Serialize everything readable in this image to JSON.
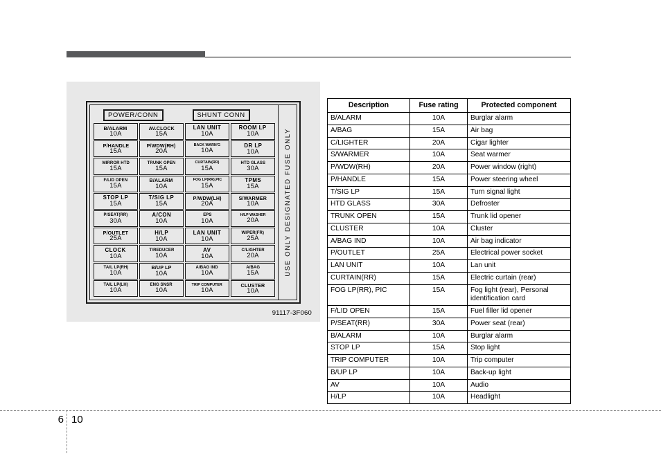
{
  "page": {
    "chapter": "6",
    "number": "10"
  },
  "figure": {
    "caption": "91117-3F060",
    "warning_text": "USE ONLY DESIGNATED FUSE ONLY",
    "connectors": [
      {
        "label": "POWER/CONN"
      },
      {
        "label": "SHUNT  CONN"
      }
    ],
    "fuses": [
      {
        "name": "B/ALARM",
        "amp": "10A",
        "size": "md"
      },
      {
        "name": "AV.CLOCK",
        "amp": "15A",
        "size": "md"
      },
      {
        "name": "LAN UNIT",
        "amp": "10A",
        "size": "lg"
      },
      {
        "name": "ROOM LP",
        "amp": "10A",
        "size": "lg"
      },
      {
        "name": "P/HANDLE",
        "amp": "15A",
        "size": "md"
      },
      {
        "name": "P/WDW(RH)",
        "amp": "20A",
        "size": "md"
      },
      {
        "name": "BACK WARN'G",
        "amp": "10A",
        "size": "xs"
      },
      {
        "name": "DR LP",
        "amp": "10A",
        "size": "lg"
      },
      {
        "name": "MIRROR HTD",
        "amp": "15A",
        "size": "sm"
      },
      {
        "name": "TRUNK OPEN",
        "amp": "15A",
        "size": "sm"
      },
      {
        "name": "CURTAIN(RR)",
        "amp": "15A",
        "size": "xs"
      },
      {
        "name": "HTD GLASS",
        "amp": "30A",
        "size": "sm"
      },
      {
        "name": "F/LID OPEN",
        "amp": "15A",
        "size": "sm"
      },
      {
        "name": "B/ALARM",
        "amp": "10A",
        "size": "md"
      },
      {
        "name": "FOG LP(RR),PIC",
        "amp": "15A",
        "size": "xs"
      },
      {
        "name": "TPMS",
        "amp": "15A",
        "size": "lg"
      },
      {
        "name": "STOP LP",
        "amp": "15A",
        "size": "lg"
      },
      {
        "name": "T/SIG LP",
        "amp": "15A",
        "size": "lg"
      },
      {
        "name": "P/WDW(LH)",
        "amp": "20A",
        "size": "md"
      },
      {
        "name": "S/WARMER",
        "amp": "10A",
        "size": "md"
      },
      {
        "name": "P/SEAT(RR)",
        "amp": "30A",
        "size": "sm"
      },
      {
        "name": "A/CON",
        "amp": "10A",
        "size": "lg"
      },
      {
        "name": "EPS",
        "amp": "10A",
        "size": "sm"
      },
      {
        "name": "H/LP WASHER",
        "amp": "20A",
        "size": "xs"
      },
      {
        "name": "P/OUTLET",
        "amp": "25A",
        "size": "md"
      },
      {
        "name": "H/LP",
        "amp": "10A",
        "size": "lg"
      },
      {
        "name": "LAN UNIT",
        "amp": "10A",
        "size": "lg"
      },
      {
        "name": "WIPER(FR)",
        "amp": "25A",
        "size": "sm"
      },
      {
        "name": "CLOCK",
        "amp": "10A",
        "size": "lg"
      },
      {
        "name": "T/REDUCER",
        "amp": "10A",
        "size": "sm"
      },
      {
        "name": "AV",
        "amp": "10A",
        "size": "lg"
      },
      {
        "name": "C/LIGHTER",
        "amp": "20A",
        "size": "sm"
      },
      {
        "name": "TAIL LP(RH)",
        "amp": "10A",
        "size": "sm"
      },
      {
        "name": "B/UP LP",
        "amp": "10A",
        "size": "md"
      },
      {
        "name": "A/BAG IND",
        "amp": "10A",
        "size": "sm"
      },
      {
        "name": "A/BAG",
        "amp": "15A",
        "size": "sm"
      },
      {
        "name": "TAIL LP(LH)",
        "amp": "10A",
        "size": "sm"
      },
      {
        "name": "ENG SNSR",
        "amp": "10A",
        "size": "sm"
      },
      {
        "name": "TRIP COMPUTER",
        "amp": "10A",
        "size": "xs"
      },
      {
        "name": "CLUSTER",
        "amp": "10A",
        "size": "md"
      }
    ]
  },
  "table": {
    "headers": [
      "Description",
      "Fuse rating",
      "Protected component"
    ],
    "rows": [
      {
        "description": "B/ALARM",
        "rating": "10A",
        "component": "Burglar alarm"
      },
      {
        "description": "A/BAG",
        "rating": "15A",
        "component": "Air bag"
      },
      {
        "description": "C/LIGHTER",
        "rating": "20A",
        "component": "Cigar lighter"
      },
      {
        "description": "S/WARMER",
        "rating": "10A",
        "component": "Seat warmer"
      },
      {
        "description": "P/WDW(RH)",
        "rating": "20A",
        "component": "Power window (right)"
      },
      {
        "description": "P/HANDLE",
        "rating": "15A",
        "component": "Power steering wheel"
      },
      {
        "description": "T/SIG LP",
        "rating": "15A",
        "component": "Turn signal light"
      },
      {
        "description": "HTD GLASS",
        "rating": "30A",
        "component": "Defroster"
      },
      {
        "description": "TRUNK OPEN",
        "rating": "15A",
        "component": "Trunk lid opener"
      },
      {
        "description": "CLUSTER",
        "rating": "10A",
        "component": "Cluster"
      },
      {
        "description": "A/BAG IND",
        "rating": "10A",
        "component": "Air bag indicator"
      },
      {
        "description": "P/OUTLET",
        "rating": "25A",
        "component": "Electrical power socket"
      },
      {
        "description": "LAN UNIT",
        "rating": "10A",
        "component": "Lan unit"
      },
      {
        "description": "CURTAIN(RR)",
        "rating": "15A",
        "component": "Electric curtain (rear)"
      },
      {
        "description": "FOG LP(RR), PIC",
        "rating": "15A",
        "component": "Fog light (rear), Personal identification card"
      },
      {
        "description": "F/LID OPEN",
        "rating": "15A",
        "component": "Fuel filler lid opener"
      },
      {
        "description": "P/SEAT(RR)",
        "rating": "30A",
        "component": "Power seat (rear)"
      },
      {
        "description": "B/ALARM",
        "rating": "10A",
        "component": "Burglar alarm"
      },
      {
        "description": "STOP LP",
        "rating": "15A",
        "component": "Stop light"
      },
      {
        "description": "TRIP COMPUTER",
        "rating": "10A",
        "component": "Trip computer"
      },
      {
        "description": "B/UP LP",
        "rating": "10A",
        "component": "Back-up light"
      },
      {
        "description": "AV",
        "rating": "10A",
        "component": "Audio"
      },
      {
        "description": "H/LP",
        "rating": "10A",
        "component": "Headlight"
      }
    ]
  }
}
